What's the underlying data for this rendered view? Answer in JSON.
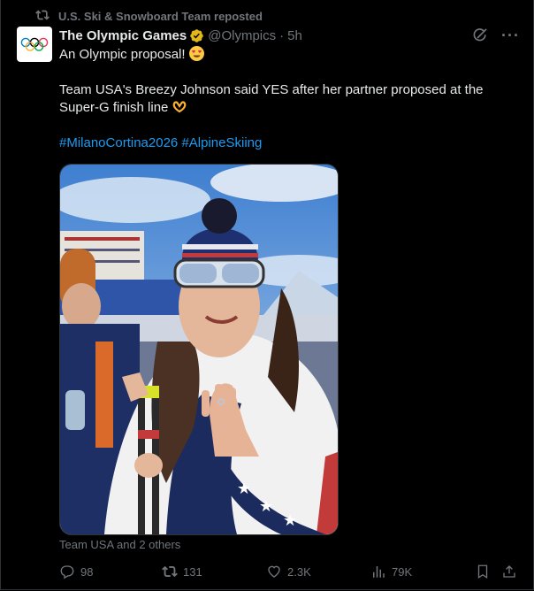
{
  "repost": {
    "text": "U.S. Ski & Snowboard Team reposted"
  },
  "author": {
    "name": "The Olympic Games",
    "handle": "@Olympics",
    "time": "5h"
  },
  "tweet": {
    "line1": "An Olympic proposal!",
    "line2": "Team USA's Breezy Johnson said YES after her partner proposed at the Super-G finish line",
    "hashtag1": "#MilanoCortina2026",
    "hashtag2": "#AlpineSkiing"
  },
  "media": {
    "tagged": "Team USA and 2 others"
  },
  "actions": {
    "replies": "98",
    "reposts": "131",
    "likes": "2.3K",
    "views": "79K"
  },
  "colors": {
    "accent": "#1d9bf0",
    "verified": "#e2b719",
    "muted": "#71767b",
    "background": "#000000"
  }
}
